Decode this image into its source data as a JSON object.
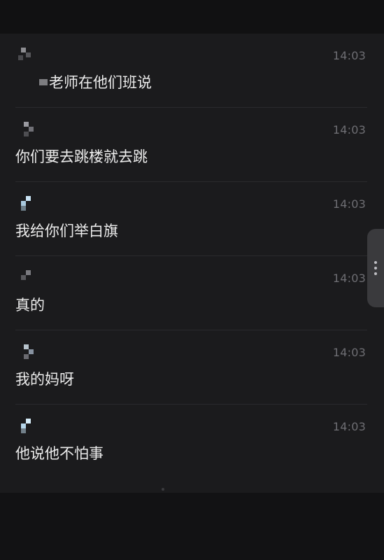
{
  "messages": [
    {
      "time": "14:03",
      "prefix_redacted": true,
      "text": "老师在他们班说"
    },
    {
      "time": "14:03",
      "prefix_redacted": false,
      "text": "你们要去跳楼就去跳"
    },
    {
      "time": "14:03",
      "prefix_redacted": false,
      "text": "我给你们举白旗"
    },
    {
      "time": "14:03",
      "prefix_redacted": false,
      "text": "真的"
    },
    {
      "time": "14:03",
      "prefix_redacted": false,
      "text": "我的妈呀"
    },
    {
      "time": "14:03",
      "prefix_redacted": false,
      "text": "他说他不怕事"
    }
  ],
  "colors": {
    "background": "#111112",
    "list_background": "#1b1b1d",
    "text": "#ececec",
    "timestamp": "#6e6e73",
    "divider": "#2a2a2d"
  },
  "icons": {
    "avatar": "pixelated-avatar-icon",
    "side_handle": "more-vertical-icon"
  }
}
